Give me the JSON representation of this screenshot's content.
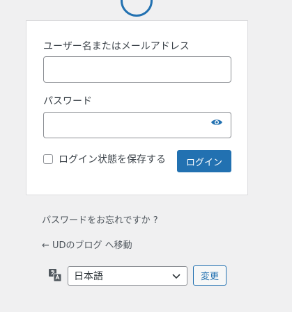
{
  "login_form": {
    "username_label": "ユーザー名またはメールアドレス",
    "username_value": "",
    "password_label": "パスワード",
    "password_value": "",
    "show_password_icon": "eye-icon",
    "remember_label": "ログイン状態を保存する",
    "remember_checked": false,
    "submit_label": "ログイン"
  },
  "links": {
    "lost_password": "パスワードをお忘れですか ?",
    "back_to_blog": "← UDのブログ へ移動"
  },
  "language": {
    "icon": "translate-icon",
    "selected": "日本語",
    "change_label": "変更"
  },
  "colors": {
    "accent": "#2271b1",
    "background": "#f0f0f1"
  }
}
